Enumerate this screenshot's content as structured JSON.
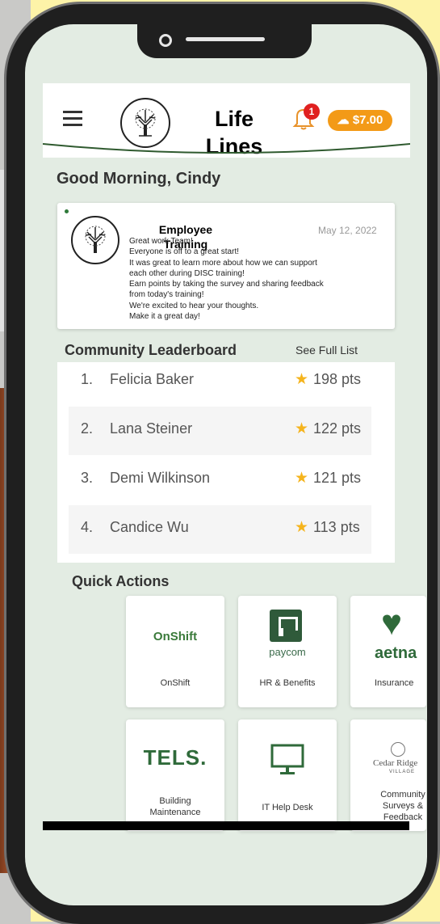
{
  "app": {
    "title": "Life Lines",
    "title_line1": "Life",
    "title_line2": "Lines",
    "notification_count": "1",
    "points_balance": "$7.00"
  },
  "greeting": "Good Morning, Cindy",
  "post": {
    "title": "Employee Training",
    "date": "May 12, 2022",
    "lines": [
      "Great work Team!",
      "Everyone is off to a great start!",
      "It was great to learn more about how we can support",
      "each other during DISC training!",
      "Earn points by taking the survey and sharing feedback",
      "from today's training!",
      "We're excited to hear your thoughts.",
      "Make it a great day!"
    ]
  },
  "leaderboard": {
    "title": "Community Leaderboard",
    "link": "See Full List",
    "rows": [
      {
        "rank": "1.",
        "name": "Felicia Baker",
        "points": "198 pts"
      },
      {
        "rank": "2.",
        "name": "Lana Steiner",
        "points": "122 pts"
      },
      {
        "rank": "3.",
        "name": "Demi Wilkinson",
        "points": "121 pts"
      },
      {
        "rank": "4.",
        "name": "Candice Wu",
        "points": "113 pts"
      }
    ]
  },
  "quick_actions": {
    "title": "Quick Actions",
    "tiles": [
      {
        "logo_text": "OnShift",
        "label": "OnShift",
        "icon": "onshift-logo"
      },
      {
        "logo_text": "paycom",
        "label": "HR & Benefits",
        "icon": "paycom-logo"
      },
      {
        "logo_text": "aetna",
        "label": "Insurance",
        "icon": "aetna-logo"
      },
      {
        "logo_text": "TELS.",
        "label": "Building Maintenance",
        "icon": "tels-logo"
      },
      {
        "logo_text": "",
        "label": "IT Help Desk",
        "icon": "monitor-icon"
      },
      {
        "logo_text": "Cedar Ridge",
        "logo_sub": "VILLAGE",
        "label": "Community Surveys & Feedback",
        "icon": "cedar-ridge-logo"
      }
    ]
  },
  "colors": {
    "brand_green": "#2f5a2f",
    "accent_orange": "#f39a17",
    "badge_red": "#e02020",
    "star": "#f5b41d",
    "screen_bg": "#e3ece3"
  }
}
